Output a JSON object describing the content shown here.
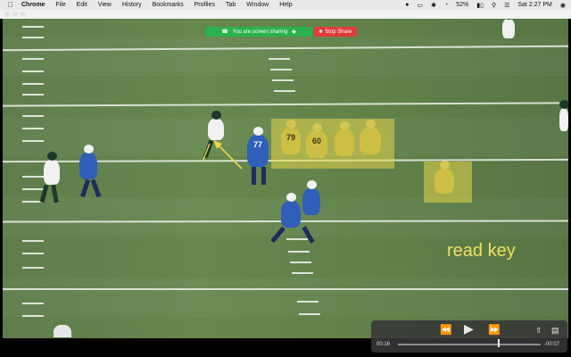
{
  "menubar": {
    "apple_icon": "apple-logo-icon",
    "app_name": "Chrome",
    "menus": [
      "File",
      "Edit",
      "View",
      "History",
      "Bookmarks",
      "Profiles",
      "Tab",
      "Window",
      "Help"
    ],
    "battery_percent": "52%",
    "clock": "Sat 2:27 PM",
    "status_icons": [
      "zoom-icon",
      "mirror-icon",
      "bluetooth-icon",
      "wifi-icon",
      "battery-icon",
      "search-icon",
      "control-center-icon",
      "siri-icon"
    ]
  },
  "window": {
    "traffic_lights": [
      {
        "name": "close",
        "color": "#e0e0e0"
      },
      {
        "name": "minimize",
        "color": "#e0e0e0"
      },
      {
        "name": "maximize",
        "color": "#e0e0e0"
      }
    ]
  },
  "share_banner": {
    "sharing_text": "You are screen sharing",
    "stop_label": "Stop Share",
    "sharing_color": "#2bb24c",
    "stop_color": "#e23b3b"
  },
  "annotation": {
    "label": "read key",
    "color": "#f0e062",
    "jersey_numbers": [
      "79",
      "60",
      "77"
    ]
  },
  "player_controls": {
    "elapsed": "00:16",
    "remaining": "-00:07",
    "progress": 0.7,
    "rewind_icon": "rewind-icon",
    "play_icon": "play-icon",
    "forward_icon": "fast-forward-icon",
    "share_icon": "share-icon",
    "pip_icon": "picture-in-picture-icon"
  }
}
